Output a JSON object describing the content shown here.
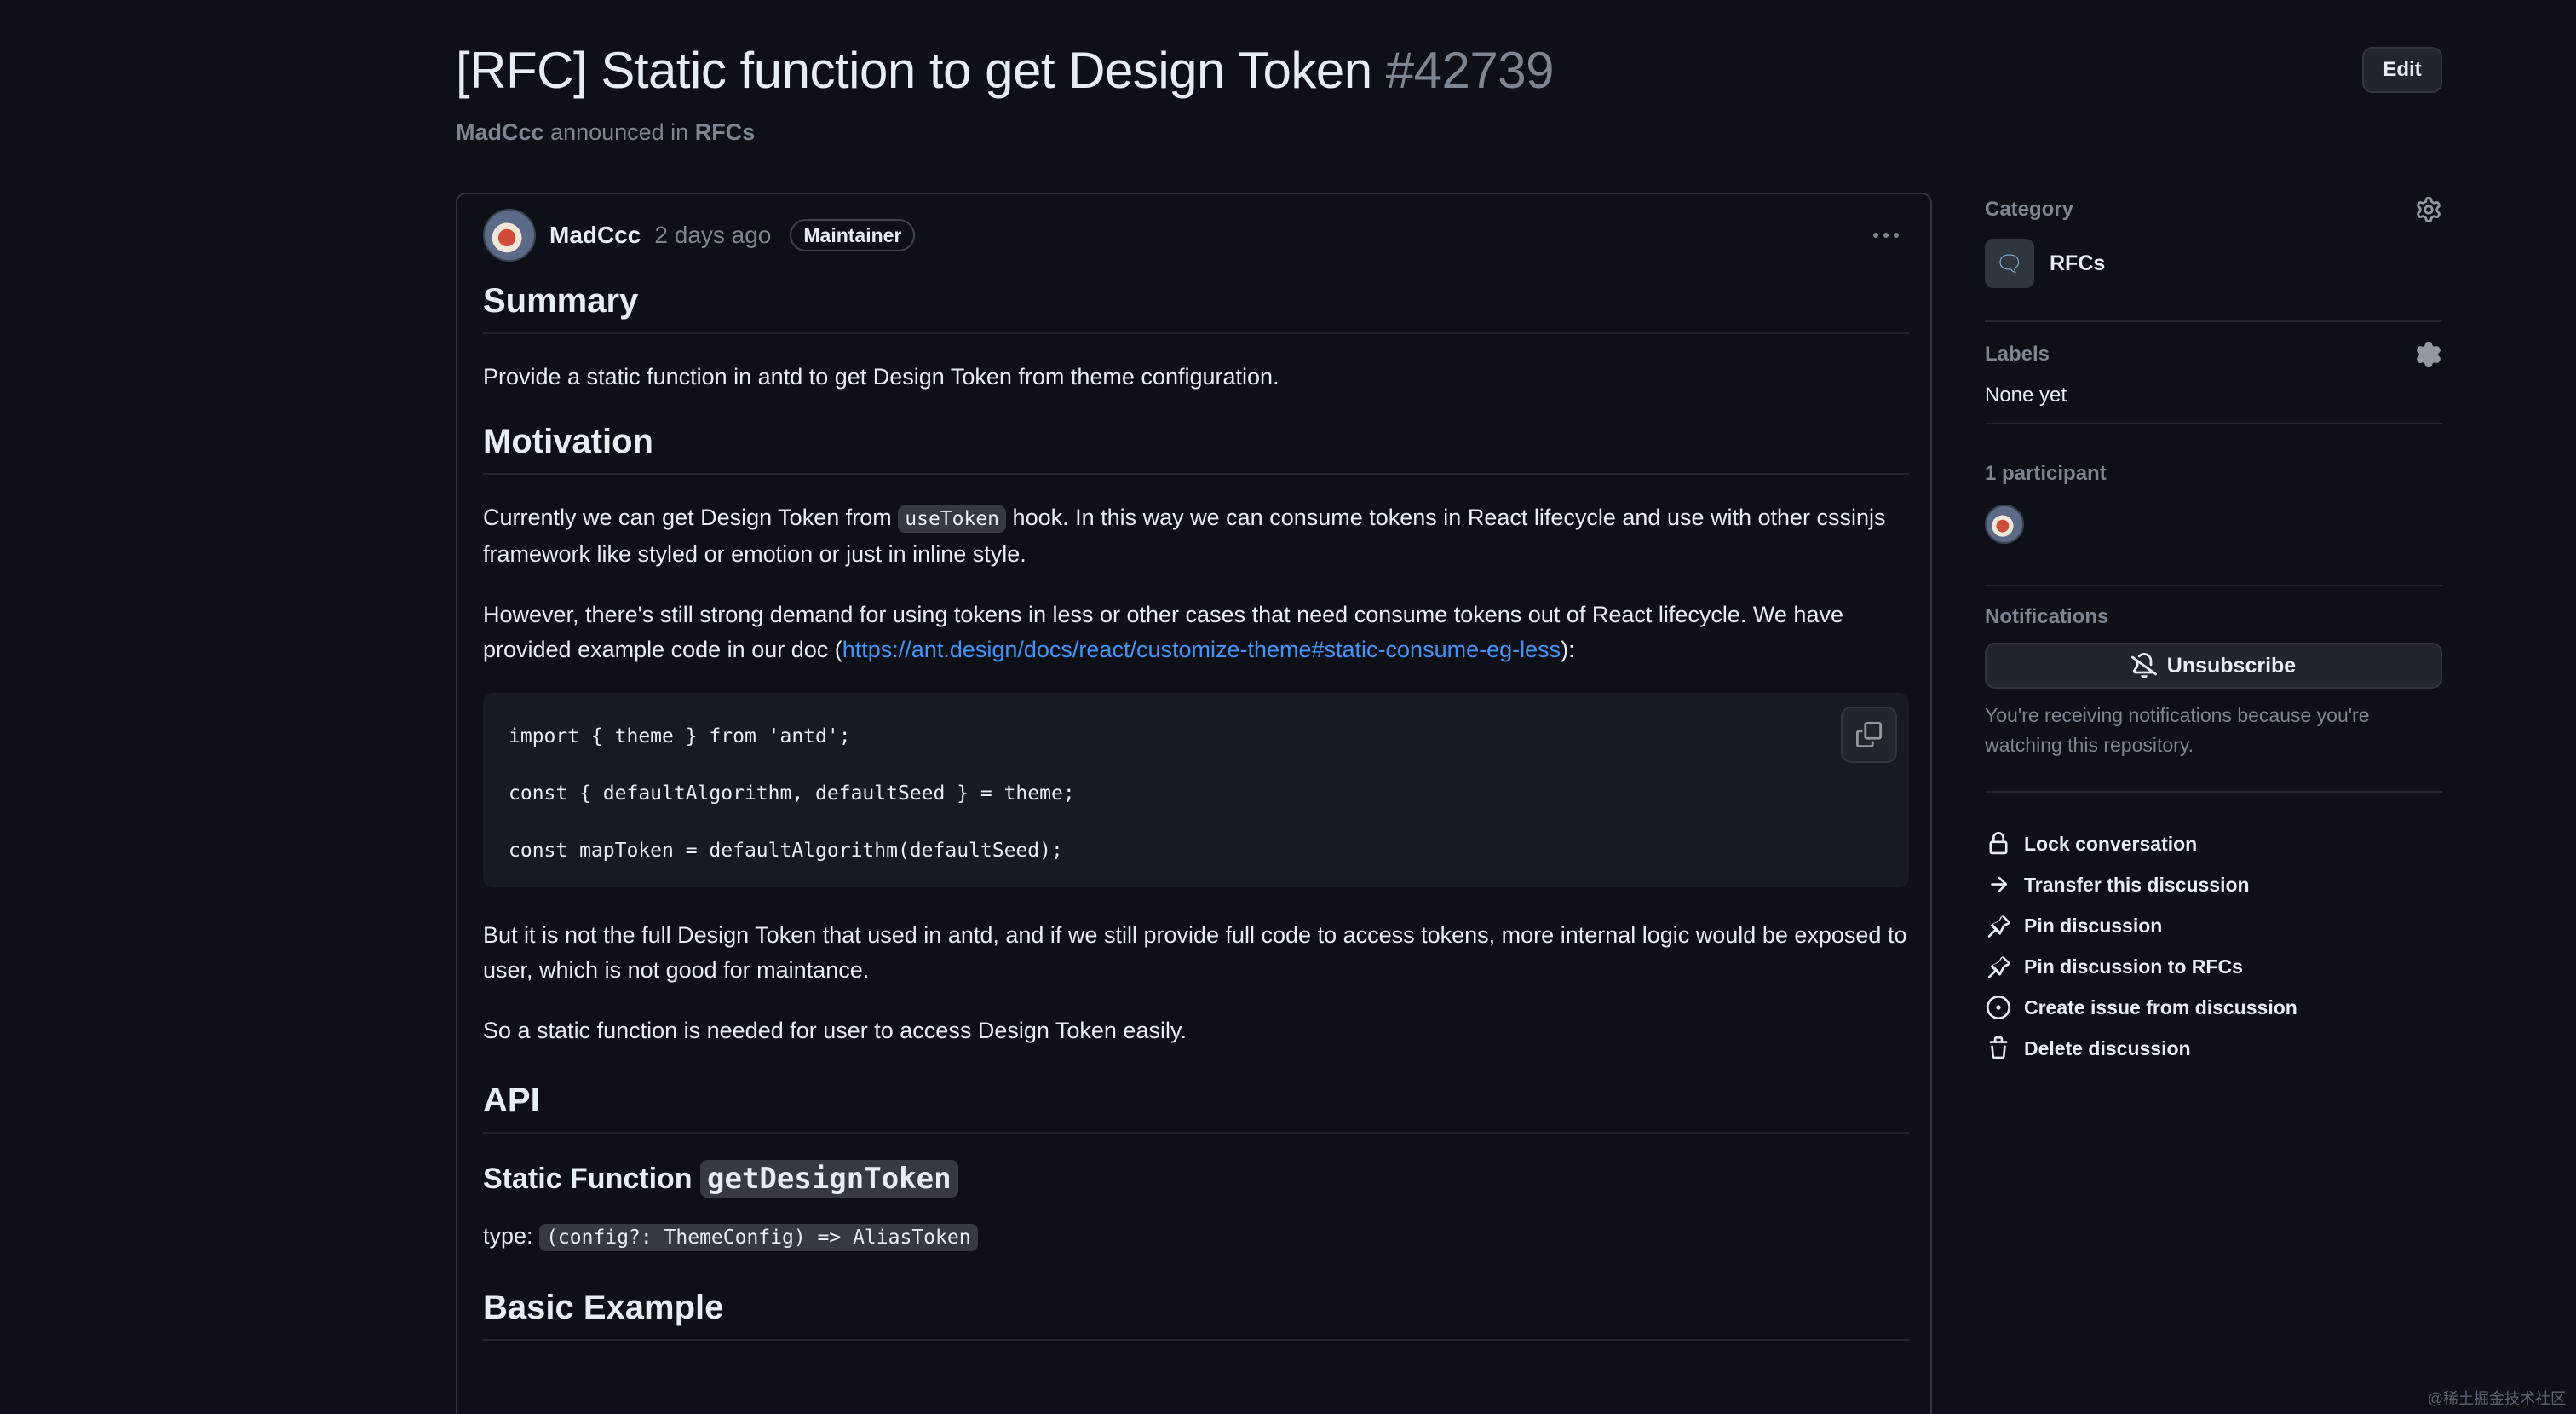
{
  "header": {
    "title": "[RFC] Static function to get Design Token",
    "number": "#42739",
    "edit_label": "Edit",
    "author": "MadCcc",
    "announced_text": "announced in",
    "category": "RFCs"
  },
  "post": {
    "author": "MadCcc",
    "time": "2 days ago",
    "badge": "Maintainer",
    "summary_heading": "Summary",
    "summary_text": "Provide a static function in antd to get Design Token from theme configuration.",
    "motivation_heading": "Motivation",
    "motivation_p1_a": "Currently we can get Design Token from",
    "motivation_p1_code": "useToken",
    "motivation_p1_b": "hook. In this way we can consume tokens in React lifecycle and use with other cssinjs framework like styled or emotion or just in inline style.",
    "motivation_p2_a": "However, there's still strong demand for using tokens in less or other cases that need consume tokens out of React lifecycle. We have provided example code in our doc (",
    "motivation_p2_link": "https://ant.design/docs/react/customize-theme#static-consume-eg-less",
    "motivation_p2_b": "):",
    "code_line1": "import { theme } from 'antd';",
    "code_line2": "const { defaultAlgorithm, defaultSeed } = theme;",
    "code_line3": "const mapToken = defaultAlgorithm(defaultSeed);",
    "p3": "But it is not the full Design Token that used in antd, and if we still provide full code to access tokens, more internal logic would be exposed to user, which is not good for maintance.",
    "p4": "So a static function is needed for user to access Design Token easily.",
    "api_heading": "API",
    "static_fn_label": "Static Function",
    "static_fn_code": "getDesignToken",
    "type_label": "type:",
    "type_code": "(config?: ThemeConfig) => AliasToken",
    "basic_example_heading": "Basic Example"
  },
  "sidebar": {
    "category_title": "Category",
    "category_name": "RFCs",
    "labels_title": "Labels",
    "labels_value": "None yet",
    "participants_title": "1 participant",
    "notifications_title": "Notifications",
    "unsubscribe_label": "Unsubscribe",
    "notifications_note": "You're receiving notifications because you're watching this repository.",
    "actions": [
      {
        "label": "Lock conversation",
        "icon": "lock-icon"
      },
      {
        "label": "Transfer this discussion",
        "icon": "arrow-right-icon"
      },
      {
        "label": "Pin discussion",
        "icon": "pin-icon"
      },
      {
        "label": "Pin discussion to RFCs",
        "icon": "pin-icon"
      },
      {
        "label": "Create issue from discussion",
        "icon": "issue-opened-icon"
      },
      {
        "label": "Delete discussion",
        "icon": "trash-icon"
      }
    ]
  },
  "watermark": "@稀土掘金技术社区"
}
